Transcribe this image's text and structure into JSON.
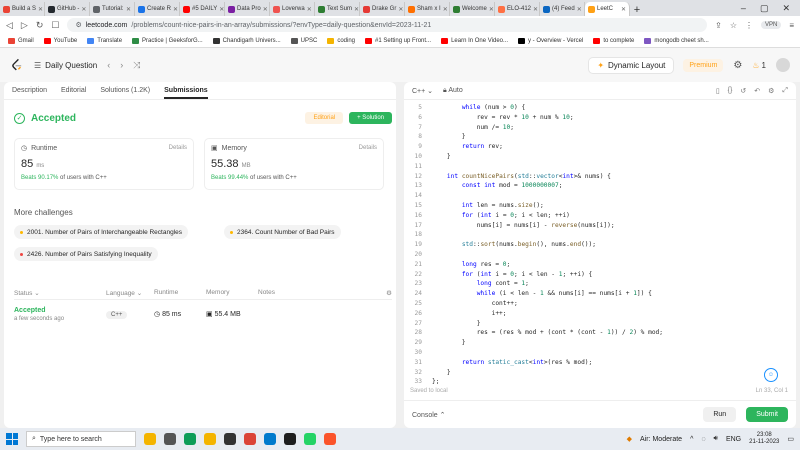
{
  "browser": {
    "tabs": [
      {
        "label": "Build a S",
        "color": "#ea4335"
      },
      {
        "label": "GitHub -",
        "color": "#24292f"
      },
      {
        "label": "Tutorial:",
        "color": "#5f6368"
      },
      {
        "label": "Create R",
        "color": "#1a73e8"
      },
      {
        "label": "#5 DAILY",
        "color": "#ff0000"
      },
      {
        "label": "Data Pro",
        "color": "#7b1fa2"
      },
      {
        "label": "Loverwa",
        "color": "#ef5350"
      },
      {
        "label": "Text Sum",
        "color": "#2e7d32"
      },
      {
        "label": "Drake Gr",
        "color": "#e53935"
      },
      {
        "label": "Sham x I",
        "color": "#ff6f00"
      },
      {
        "label": "Welcome",
        "color": "#2e7d32"
      },
      {
        "label": "ELO-412",
        "color": "#ff7043"
      },
      {
        "label": "(4) Feed",
        "color": "#0a66c2"
      },
      {
        "label": "LeetC",
        "color": "#ffa116",
        "active": true
      }
    ],
    "url_prefix": "leetcode.com",
    "url_path": "/problems/count-nice-pairs-in-an-array/submissions/?envType=daily-question&envId=2023-11-21",
    "vpn_label": "VPN",
    "bookmarks": [
      {
        "label": "Gmail",
        "color": "#ea4335"
      },
      {
        "label": "YouTube",
        "color": "#ff0000"
      },
      {
        "label": "Translate",
        "color": "#4285f4"
      },
      {
        "label": "Practice | GeeksforG...",
        "color": "#2f8d46"
      },
      {
        "label": "Chandigarh Univers...",
        "color": "#333333"
      },
      {
        "label": "UPSC",
        "color": "#555555"
      },
      {
        "label": "coding",
        "color": "#f4b400"
      },
      {
        "label": "#1 Setting up Front...",
        "color": "#ff0000"
      },
      {
        "label": "Learn In One Video...",
        "color": "#ff0000"
      },
      {
        "label": "y - Overview - Vercel",
        "color": "#000000"
      },
      {
        "label": "to complete",
        "color": "#ff0000"
      },
      {
        "label": "mongodb cheet sh...",
        "color": "#7e57c2"
      }
    ]
  },
  "header": {
    "title": "Daily Question",
    "dynamic_layout": "Dynamic Layout",
    "premium": "Premium",
    "streak": "1"
  },
  "left": {
    "tabs": [
      "Description",
      "Editorial",
      "Solutions (1.2K)",
      "Submissions"
    ],
    "status": "Accepted",
    "editorial_btn": "Editorial",
    "solution_btn": "+ Solution",
    "runtime": {
      "label": "Runtime",
      "details": "Details",
      "value": "85",
      "unit": "ms",
      "beats_pct": "Beats 90.17%",
      "beats_rest": "of users with C++"
    },
    "memory": {
      "label": "Memory",
      "details": "Details",
      "value": "55.38",
      "unit": "MB",
      "beats_pct": "Beats 99.44%",
      "beats_rest": "of users with C++"
    },
    "more_title": "More challenges",
    "challenges": [
      {
        "label": "2001. Number of Pairs of Interchangeable Rectangles",
        "color": "#ffb800"
      },
      {
        "label": "2364. Count Number of Bad Pairs",
        "color": "#ffb800"
      },
      {
        "label": "2426. Number of Pairs Satisfying Inequality",
        "color": "#ef4743"
      }
    ],
    "table": {
      "headers": [
        "Status",
        "Language",
        "Runtime",
        "Memory",
        "Notes"
      ],
      "row": {
        "status": "Accepted",
        "time": "a few seconds ago",
        "language": "C++",
        "runtime": "85 ms",
        "memory": "55.4 MB"
      }
    }
  },
  "right": {
    "lang": "C++",
    "auto": "Auto",
    "saved": "Saved to local",
    "cursor": "Ln 33, Col 1",
    "console": "Console",
    "run": "Run",
    "submit": "Submit",
    "code": [
      {
        "n": "5",
        "t": "        while (num > 0) {"
      },
      {
        "n": "6",
        "t": "            rev = rev * 10 + num % 10;"
      },
      {
        "n": "7",
        "t": "            num /= 10;"
      },
      {
        "n": "8",
        "t": "        }"
      },
      {
        "n": "9",
        "t": "        return rev;"
      },
      {
        "n": "10",
        "t": "    }"
      },
      {
        "n": "11",
        "t": ""
      },
      {
        "n": "12",
        "t": "    int countNicePairs(std::vector<int>& nums) {"
      },
      {
        "n": "13",
        "t": "        const int mod = 1000000007;"
      },
      {
        "n": "14",
        "t": ""
      },
      {
        "n": "15",
        "t": "        int len = nums.size();"
      },
      {
        "n": "16",
        "t": "        for (int i = 0; i < len; ++i)"
      },
      {
        "n": "17",
        "t": "            nums[i] = nums[i] - reverse(nums[i]);"
      },
      {
        "n": "18",
        "t": ""
      },
      {
        "n": "19",
        "t": "        std::sort(nums.begin(), nums.end());"
      },
      {
        "n": "20",
        "t": ""
      },
      {
        "n": "21",
        "t": "        long res = 0;"
      },
      {
        "n": "22",
        "t": "        for (int i = 0; i < len - 1; ++i) {"
      },
      {
        "n": "23",
        "t": "            long cont = 1;"
      },
      {
        "n": "24",
        "t": "            while (i < len - 1 && nums[i] == nums[i + 1]) {"
      },
      {
        "n": "25",
        "t": "                cont++;"
      },
      {
        "n": "26",
        "t": "                i++;"
      },
      {
        "n": "27",
        "t": "            }"
      },
      {
        "n": "28",
        "t": "            res = (res % mod + (cont * (cont - 1)) / 2) % mod;"
      },
      {
        "n": "29",
        "t": "        }"
      },
      {
        "n": "30",
        "t": ""
      },
      {
        "n": "31",
        "t": "        return static_cast<int>(res % mod);"
      },
      {
        "n": "32",
        "t": "    }"
      },
      {
        "n": "33",
        "t": "};"
      }
    ]
  },
  "taskbar": {
    "search": "Type here to search",
    "weather": "Air: Moderate",
    "lang": "ENG",
    "time": "23:08",
    "date": "21-11-2023"
  }
}
